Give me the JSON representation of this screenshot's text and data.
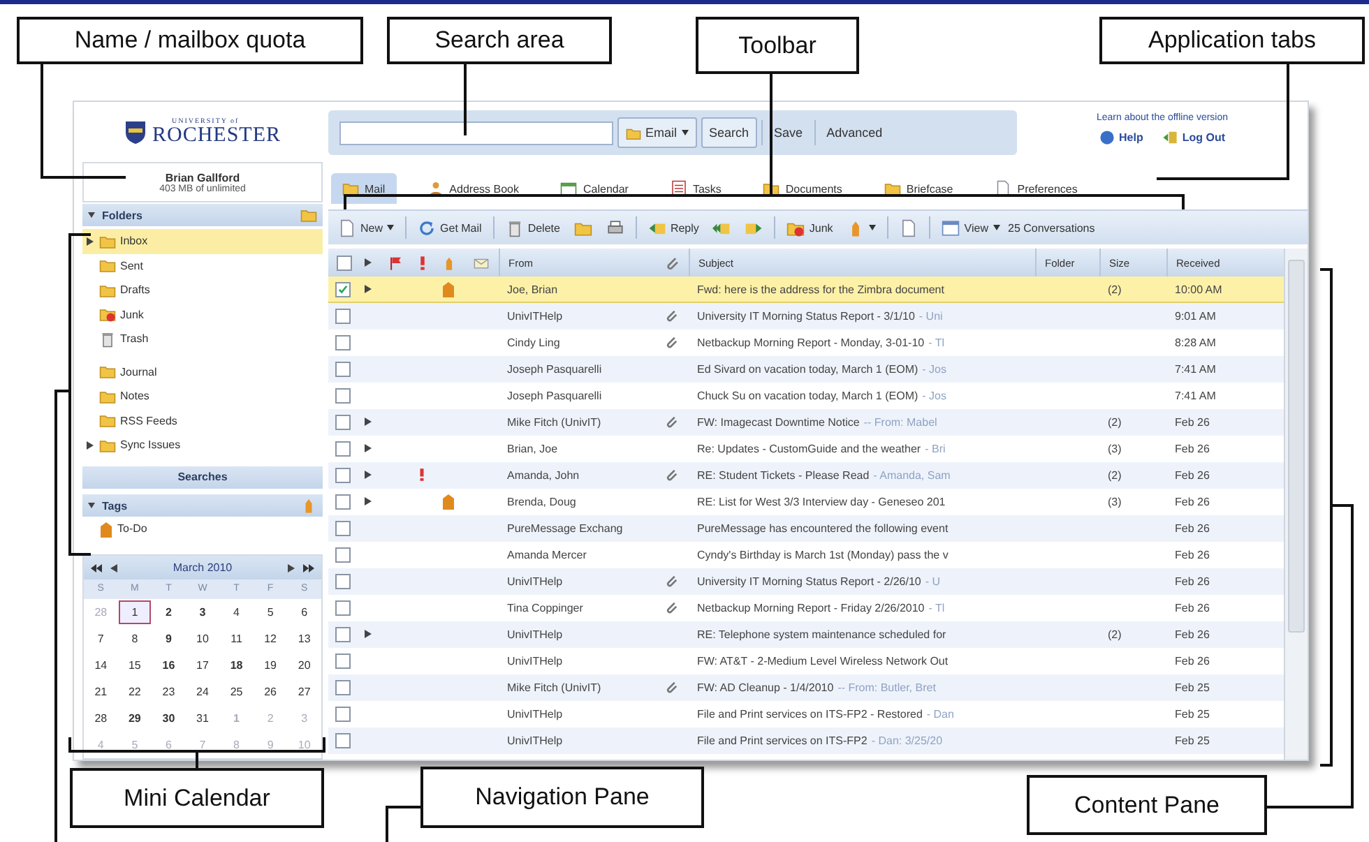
{
  "callouts": [
    {
      "kind": "quota",
      "label": "Name / mailbox quota"
    },
    {
      "kind": "search",
      "label": "Search area"
    },
    {
      "kind": "toolbar",
      "label": "Toolbar"
    },
    {
      "kind": "tabs",
      "label": "Application tabs"
    },
    {
      "kind": "calendar",
      "label": "Mini Calendar"
    },
    {
      "kind": "navigation",
      "label": "Navigation Pane"
    },
    {
      "kind": "content",
      "label": "Content Pane"
    }
  ],
  "logo": {
    "small": "UNIVERSITY of",
    "name": "ROCHESTER"
  },
  "search": {
    "scope": "Email",
    "buttons": [
      "Search",
      "Save",
      "Advanced"
    ]
  },
  "header_links": {
    "offline": "Learn about the offline version",
    "help": "Help",
    "logout": "Log Out"
  },
  "user": {
    "name": "Brian Gallford",
    "quota": "403 MB of unlimited"
  },
  "folders": {
    "title": "Folders",
    "expanded": true,
    "groups": [
      [
        {
          "label": "Inbox",
          "kind": "inbox",
          "selected": true,
          "expandable": true
        },
        {
          "label": "Sent",
          "kind": "sent",
          "selected": false,
          "expandable": false
        },
        {
          "label": "Drafts",
          "kind": "drafts",
          "selected": false,
          "expandable": false
        },
        {
          "label": "Junk",
          "kind": "junk",
          "selected": false,
          "expandable": false
        },
        {
          "label": "Trash",
          "kind": "trash",
          "selected": false,
          "expandable": false
        }
      ],
      [
        {
          "label": "Journal",
          "kind": "folder",
          "selected": false,
          "expandable": false
        },
        {
          "label": "Notes",
          "kind": "folder",
          "selected": false,
          "expandable": false
        },
        {
          "label": "RSS Feeds",
          "kind": "folder",
          "selected": false,
          "expandable": false
        },
        {
          "label": "Sync Issues",
          "kind": "folder",
          "selected": false,
          "expandable": true
        }
      ]
    ]
  },
  "searches": {
    "title": "Searches"
  },
  "tags": {
    "title": "Tags",
    "expanded": true,
    "items": [
      {
        "label": "To-Do",
        "color": "#e08a1e"
      }
    ]
  },
  "calendar": {
    "title": "March 2010",
    "weekdays": [
      "S",
      "M",
      "T",
      "W",
      "T",
      "F",
      "S"
    ],
    "weeks": [
      [
        {
          "day": "28",
          "outside": true,
          "bold": false,
          "today": false
        },
        {
          "day": "1",
          "outside": false,
          "bold": false,
          "today": true
        },
        {
          "day": "2",
          "outside": false,
          "bold": true,
          "today": false
        },
        {
          "day": "3",
          "outside": false,
          "bold": true,
          "today": false
        },
        {
          "day": "4",
          "outside": false,
          "bold": false,
          "today": false
        },
        {
          "day": "5",
          "outside": false,
          "bold": false,
          "today": false
        },
        {
          "day": "6",
          "outside": false,
          "bold": false,
          "today": false
        }
      ],
      [
        {
          "day": "7",
          "outside": false,
          "bold": false,
          "today": false
        },
        {
          "day": "8",
          "outside": false,
          "bold": false,
          "today": false
        },
        {
          "day": "9",
          "outside": false,
          "bold": true,
          "today": false
        },
        {
          "day": "10",
          "outside": false,
          "bold": false,
          "today": false
        },
        {
          "day": "11",
          "outside": false,
          "bold": false,
          "today": false
        },
        {
          "day": "12",
          "outside": false,
          "bold": false,
          "today": false
        },
        {
          "day": "13",
          "outside": false,
          "bold": false,
          "today": false
        }
      ],
      [
        {
          "day": "14",
          "outside": false,
          "bold": false,
          "today": false
        },
        {
          "day": "15",
          "outside": false,
          "bold": false,
          "today": false
        },
        {
          "day": "16",
          "outside": false,
          "bold": true,
          "today": false
        },
        {
          "day": "17",
          "outside": false,
          "bold": false,
          "today": false
        },
        {
          "day": "18",
          "outside": false,
          "bold": true,
          "today": false
        },
        {
          "day": "19",
          "outside": false,
          "bold": false,
          "today": false
        },
        {
          "day": "20",
          "outside": false,
          "bold": false,
          "today": false
        }
      ],
      [
        {
          "day": "21",
          "outside": false,
          "bold": false,
          "today": false
        },
        {
          "day": "22",
          "outside": false,
          "bold": false,
          "today": false
        },
        {
          "day": "23",
          "outside": false,
          "bold": false,
          "today": false
        },
        {
          "day": "24",
          "outside": false,
          "bold": false,
          "today": false
        },
        {
          "day": "25",
          "outside": false,
          "bold": false,
          "today": false
        },
        {
          "day": "26",
          "outside": false,
          "bold": false,
          "today": false
        },
        {
          "day": "27",
          "outside": false,
          "bold": false,
          "today": false
        }
      ],
      [
        {
          "day": "28",
          "outside": false,
          "bold": false,
          "today": false
        },
        {
          "day": "29",
          "outside": false,
          "bold": true,
          "today": false
        },
        {
          "day": "30",
          "outside": false,
          "bold": true,
          "today": false
        },
        {
          "day": "31",
          "outside": false,
          "bold": false,
          "today": false
        },
        {
          "day": "1",
          "outside": true,
          "bold": true,
          "today": false
        },
        {
          "day": "2",
          "outside": true,
          "bold": false,
          "today": false
        },
        {
          "day": "3",
          "outside": true,
          "bold": false,
          "today": false
        }
      ],
      [
        {
          "day": "4",
          "outside": true,
          "bold": false,
          "today": false
        },
        {
          "day": "5",
          "outside": true,
          "bold": false,
          "today": false
        },
        {
          "day": "6",
          "outside": true,
          "bold": false,
          "today": false
        },
        {
          "day": "7",
          "outside": true,
          "bold": false,
          "today": false
        },
        {
          "day": "8",
          "outside": true,
          "bold": false,
          "today": false
        },
        {
          "day": "9",
          "outside": true,
          "bold": false,
          "today": false
        },
        {
          "day": "10",
          "outside": true,
          "bold": false,
          "today": false
        }
      ]
    ]
  },
  "tabs": [
    {
      "label": "Mail",
      "kind": "mail",
      "selected": true
    },
    {
      "label": "Address Book",
      "kind": "contacts",
      "selected": false
    },
    {
      "label": "Calendar",
      "kind": "calendar",
      "selected": false
    },
    {
      "label": "Tasks",
      "kind": "tasks",
      "selected": false
    },
    {
      "label": "Documents",
      "kind": "documents",
      "selected": false
    },
    {
      "label": "Briefcase",
      "kind": "briefcase",
      "selected": false
    },
    {
      "label": "Preferences",
      "kind": "preferences",
      "selected": false
    }
  ],
  "toolbar": [
    {
      "kind": "new",
      "label": "New",
      "menu": true
    },
    {
      "kind": "getmail",
      "label": "Get Mail",
      "menu": false
    },
    {
      "kind": "delete",
      "label": "Delete",
      "menu": false
    },
    {
      "kind": "move",
      "menu": false
    },
    {
      "kind": "print",
      "menu": false
    },
    {
      "kind": "reply",
      "label": "Reply",
      "menu": false
    },
    {
      "kind": "replyall",
      "menu": false
    },
    {
      "kind": "forward",
      "menu": false
    },
    {
      "kind": "junk",
      "label": "Junk",
      "menu": false
    },
    {
      "kind": "tag",
      "menu": true
    },
    {
      "kind": "page",
      "menu": false
    },
    {
      "kind": "view",
      "label": "View",
      "menu": true
    },
    {
      "kind": "count",
      "label": "25 Conversations"
    }
  ],
  "list": {
    "select_all_checked": false,
    "columns": {
      "from": "From",
      "subject": "Subject",
      "folder": "Folder",
      "size": "Size",
      "received": "Received"
    },
    "rows": [
      {
        "from": "Joe, Brian",
        "subject": "Fwd: here is the address for the Zimbra document",
        "count": "(2)",
        "received": "10:00 AM",
        "checked": true,
        "selected": true,
        "thread": true,
        "attachment": false,
        "priority": false,
        "tag": {
          "color": "#e08a1e"
        }
      },
      {
        "from": "UnivITHelp",
        "subject": "University IT Morning Status Report - 3/1/10",
        "snippet": "- Uni",
        "received": "9:01 AM",
        "checked": false,
        "selected": false,
        "thread": false,
        "attachment": true,
        "priority": false
      },
      {
        "from": "Cindy Ling",
        "subject": "Netbackup Morning Report - Monday, 3-01-10",
        "snippet": "- Tl",
        "received": "8:28 AM",
        "checked": false,
        "selected": false,
        "thread": false,
        "attachment": true,
        "priority": false
      },
      {
        "from": "Joseph Pasquarelli",
        "subject": "Ed Sivard on vacation today, March 1 (EOM)",
        "snippet": "- Jos",
        "received": "7:41 AM",
        "checked": false,
        "selected": false,
        "thread": false,
        "attachment": false,
        "priority": false
      },
      {
        "from": "Joseph Pasquarelli",
        "subject": "Chuck Su on vacation today, March 1 (EOM)",
        "snippet": "- Jos",
        "received": "7:41 AM",
        "checked": false,
        "selected": false,
        "thread": false,
        "attachment": false,
        "priority": false
      },
      {
        "from": "Mike Fitch (UnivIT)",
        "subject": "FW: Imagecast Downtime Notice",
        "snippet": "-- From: Mabel",
        "count": "(2)",
        "received": "Feb 26",
        "checked": false,
        "selected": false,
        "thread": true,
        "attachment": true,
        "priority": false
      },
      {
        "from": "Brian, Joe",
        "subject": "Re: Updates - CustomGuide and the weather",
        "snippet": "- Bri",
        "count": "(3)",
        "received": "Feb 26",
        "checked": false,
        "selected": false,
        "thread": true,
        "attachment": false,
        "priority": false
      },
      {
        "from": "Amanda, John",
        "subject": "RE: Student Tickets - Please Read",
        "snippet": "- Amanda, Sam",
        "count": "(2)",
        "received": "Feb 26",
        "checked": false,
        "selected": false,
        "thread": true,
        "attachment": true,
        "priority": true
      },
      {
        "from": "Brenda, Doug",
        "subject": "RE: List for West 3/3 Interview day - Geneseo 201",
        "count": "(3)",
        "received": "Feb 26",
        "checked": false,
        "selected": false,
        "thread": true,
        "attachment": false,
        "priority": false,
        "tag": {
          "color": "#e08a1e"
        }
      },
      {
        "from": "PureMessage Exchang",
        "subject": "PureMessage has encountered the following event",
        "received": "Feb 26",
        "checked": false,
        "selected": false,
        "thread": false,
        "attachment": false,
        "priority": false
      },
      {
        "from": "Amanda Mercer",
        "subject": "Cyndy's Birthday is March 1st (Monday) pass the v",
        "received": "Feb 26",
        "checked": false,
        "selected": false,
        "thread": false,
        "attachment": false,
        "priority": false
      },
      {
        "from": "UnivITHelp",
        "subject": "University IT Morning Status Report - 2/26/10",
        "snippet": "- U",
        "received": "Feb 26",
        "checked": false,
        "selected": false,
        "thread": false,
        "attachment": true,
        "priority": false
      },
      {
        "from": "Tina Coppinger",
        "subject": "Netbackup Morning Report - Friday 2/26/2010",
        "snippet": "- Tl",
        "received": "Feb 26",
        "checked": false,
        "selected": false,
        "thread": false,
        "attachment": true,
        "priority": false
      },
      {
        "from": "UnivITHelp",
        "subject": "RE: Telephone system maintenance scheduled for",
        "count": "(2)",
        "received": "Feb 26",
        "checked": false,
        "selected": false,
        "thread": true,
        "attachment": false,
        "priority": false
      },
      {
        "from": "UnivITHelp",
        "subject": "FW: AT&T - 2-Medium Level Wireless Network Out",
        "received": "Feb 26",
        "checked": false,
        "selected": false,
        "thread": false,
        "attachment": false,
        "priority": false
      },
      {
        "from": "Mike Fitch (UnivIT)",
        "subject": "FW: AD Cleanup - 1/4/2010",
        "snippet": "-- From: Butler, Bret",
        "received": "Feb 25",
        "checked": false,
        "selected": false,
        "thread": false,
        "attachment": true,
        "priority": false
      },
      {
        "from": "UnivITHelp",
        "subject": "File and Print services on ITS-FP2 - Restored",
        "snippet": "- Dan",
        "received": "Feb 25",
        "checked": false,
        "selected": false,
        "thread": false,
        "attachment": false,
        "priority": false
      },
      {
        "from": "UnivITHelp",
        "subject": "File and Print services on ITS-FP2",
        "snippet": "- Dan: 3/25/20",
        "received": "Feb 25",
        "checked": false,
        "selected": false,
        "thread": false,
        "attachment": false,
        "priority": false
      }
    ]
  }
}
